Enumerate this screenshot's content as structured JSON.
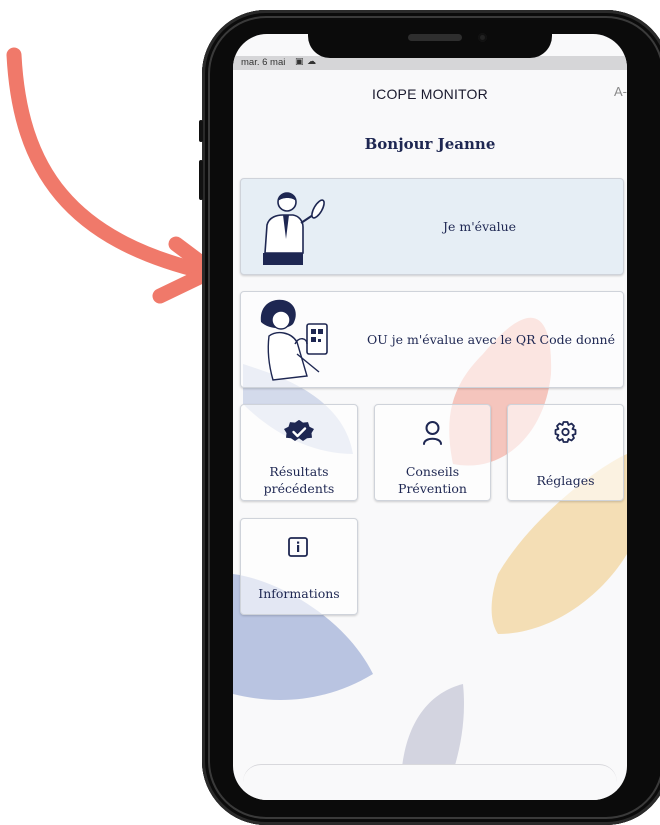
{
  "status_bar": {
    "time": "mar. 6 mai"
  },
  "app": {
    "title": "ICOPE MONITOR",
    "font_size_toggle": "A-"
  },
  "greeting": "Bonjour Jeanne",
  "actions": {
    "self_assess": "Je m'évalue",
    "qr_assess": "OU je m'évalue avec le QR Code donné"
  },
  "tiles": [
    {
      "line1": "Résultats",
      "line2": "précédents",
      "icon": "verified-badge-icon"
    },
    {
      "line1": "Conseils",
      "line2": "Prévention",
      "icon": "person-icon"
    },
    {
      "line1": "Réglages",
      "line2": "",
      "icon": "gear-icon"
    },
    {
      "line1": "Informations",
      "line2": "",
      "icon": "info-icon"
    }
  ],
  "colors": {
    "accent_navy": "#1e2752",
    "arrow": "#f0796a",
    "primary_card_bg": "#e6eef5",
    "blob_red": "#f3b3a8",
    "blob_gold": "#f3d9a8",
    "blob_blue": "#aebbdc",
    "blob_grey": "#c9cbda"
  }
}
